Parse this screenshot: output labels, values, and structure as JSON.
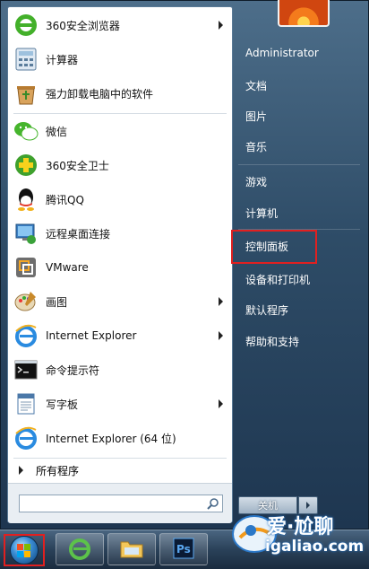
{
  "programs": [
    {
      "label": "360安全浏览器",
      "icon": "360-browser-icon",
      "has_arrow": true
    },
    {
      "label": "计算器",
      "icon": "calculator-icon",
      "has_arrow": false
    },
    {
      "label": "强力卸载电脑中的软件",
      "icon": "uninstall-icon",
      "has_arrow": false
    },
    {
      "label": "微信",
      "icon": "wechat-icon",
      "has_arrow": false
    },
    {
      "label": "360安全卫士",
      "icon": "360-safe-icon",
      "has_arrow": false
    },
    {
      "label": "腾讯QQ",
      "icon": "qq-icon",
      "has_arrow": false
    },
    {
      "label": "远程桌面连接",
      "icon": "remote-desktop-icon",
      "has_arrow": false
    },
    {
      "label": "VMware",
      "icon": "vmware-icon",
      "has_arrow": false
    },
    {
      "label": "画图",
      "icon": "paint-icon",
      "has_arrow": true
    },
    {
      "label": "Internet Explorer",
      "icon": "ie-icon",
      "has_arrow": true
    },
    {
      "label": "命令提示符",
      "icon": "cmd-icon",
      "has_arrow": false
    },
    {
      "label": "写字板",
      "icon": "wordpad-icon",
      "has_arrow": true
    },
    {
      "label": "Internet Explorer (64 位)",
      "icon": "ie-icon",
      "has_arrow": false
    }
  ],
  "all_programs": "所有程序",
  "search": {
    "placeholder": "",
    "value": ""
  },
  "user": {
    "name": "Administrator"
  },
  "right_items": [
    {
      "label": "文档"
    },
    {
      "label": "图片"
    },
    {
      "label": "音乐"
    },
    {
      "label": "游戏"
    },
    {
      "label": "计算机"
    },
    {
      "label": "控制面板"
    },
    {
      "label": "设备和打印机"
    },
    {
      "label": "默认程序"
    },
    {
      "label": "帮助和支持"
    }
  ],
  "shutdown_label": "关机",
  "watermark": {
    "line1": "爱·尬聊",
    "line2": "igaliao.com"
  },
  "colors": {
    "highlight": "#e02020",
    "menu_bg": "#2e4c67"
  }
}
